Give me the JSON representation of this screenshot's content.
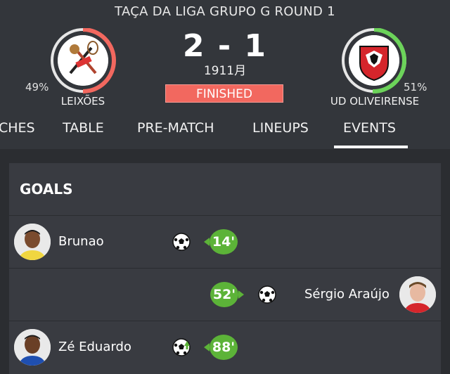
{
  "competition": "TAÇA DA LIGA  GRUPO G ROUND 1",
  "home": {
    "name": "LEIXÕES",
    "possession": "49%",
    "ring_color": "#f2685f"
  },
  "away": {
    "name": "UD OLIVEIRENSE",
    "possession": "51%",
    "ring_color": "#6cd35a"
  },
  "score": "2 - 1",
  "date": "1911月",
  "status": "FINISHED",
  "tabs": [
    "CHES",
    "TABLE",
    "PRE-MATCH",
    "LINEUPS",
    "EVENTS"
  ],
  "active_tab": "EVENTS",
  "section_title": "GOALS",
  "events": [
    {
      "player": "Brunao",
      "minute": "14'",
      "side": "home",
      "icon": "soccer-ball-icon"
    },
    {
      "player": "Sérgio Araújo",
      "minute": "52'",
      "side": "away",
      "icon": "soccer-ball-icon"
    },
    {
      "player": "Zé Eduardo",
      "minute": "88'",
      "side": "home",
      "icon": "soccer-ball-assist-icon"
    }
  ]
}
